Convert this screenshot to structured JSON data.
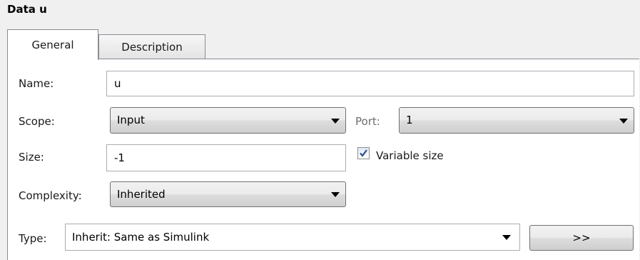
{
  "dialog": {
    "title": "Data u"
  },
  "tabs": [
    {
      "label": "General",
      "active": true
    },
    {
      "label": "Description",
      "active": false
    }
  ],
  "form": {
    "name": {
      "label": "Name:",
      "value": "u"
    },
    "scope": {
      "label": "Scope:",
      "value": "Input"
    },
    "port": {
      "label": "Port:",
      "value": "1"
    },
    "size": {
      "label": "Size:",
      "value": "-1"
    },
    "variable_size": {
      "label": "Variable size",
      "checked": true
    },
    "complexity": {
      "label": "Complexity:",
      "value": "Inherited"
    },
    "type": {
      "label": "Type:",
      "value": "Inherit: Same as Simulink"
    },
    "type_assistant_button": {
      "label": ">>"
    }
  },
  "icons": [
    "chevron-down-icon",
    "checkmark-icon"
  ],
  "colors": {
    "checkmark": "#2e4e8c",
    "panel_border": "#898c95"
  }
}
